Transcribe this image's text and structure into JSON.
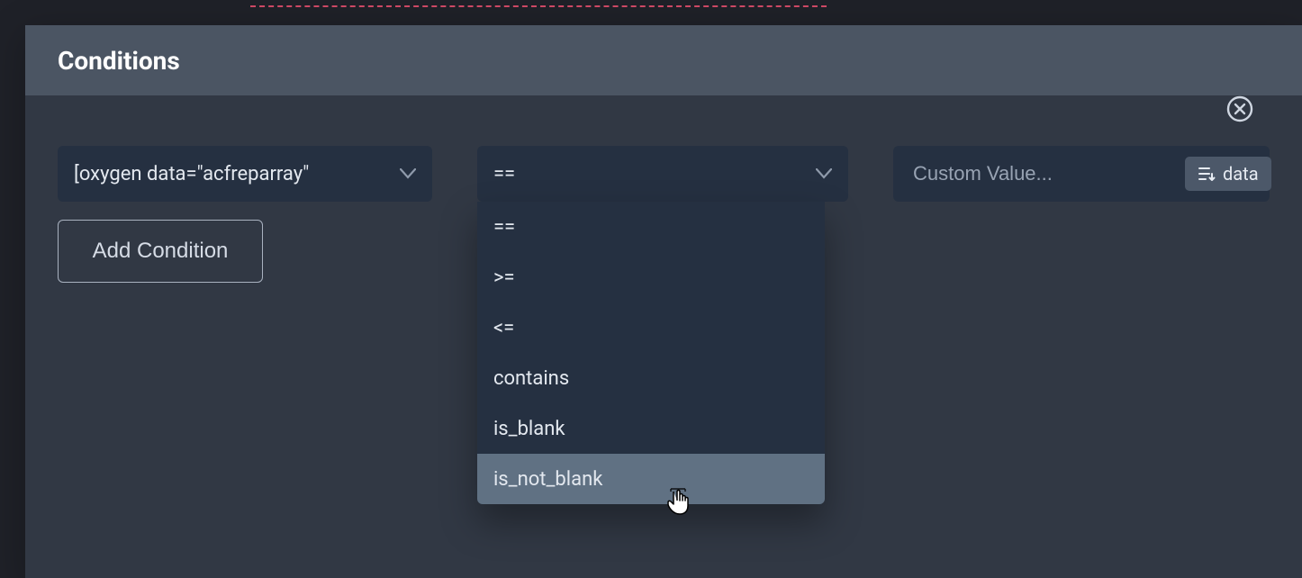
{
  "header": {
    "title": "Conditions"
  },
  "condition_row": {
    "field_select": {
      "value": "[oxygen data=\"acfreparray\""
    },
    "operator_select": {
      "value": "==",
      "options": [
        "==",
        ">=",
        "<=",
        "contains",
        "is_blank",
        "is_not_blank"
      ],
      "hovered_index": 5
    },
    "value_input": {
      "placeholder": "Custom Value...",
      "value": ""
    },
    "data_button_label": "data"
  },
  "buttons": {
    "add_condition": "Add Condition"
  },
  "icons": {
    "chevron_down": "chevron-down-icon",
    "close": "close-icon",
    "data": "data-icon",
    "cursor": "pointer-cursor-icon"
  }
}
